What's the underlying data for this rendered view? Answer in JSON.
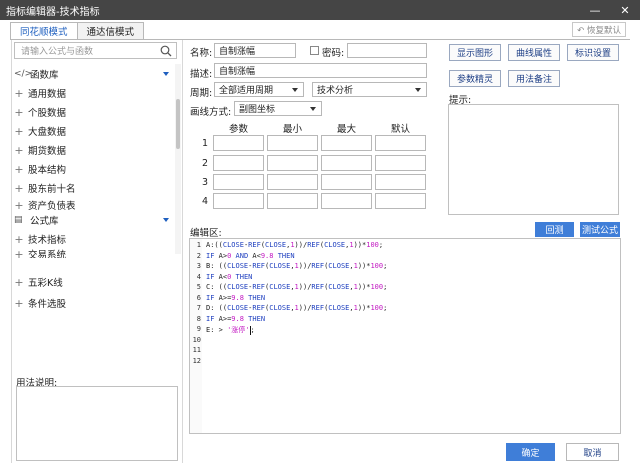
{
  "window": {
    "title": "指标编辑器-技术指标",
    "minimize": "—",
    "close": "✕"
  },
  "tabs": [
    {
      "label": "同花顺模式"
    },
    {
      "label": "通达信模式"
    }
  ],
  "restore_default": "↶ 恢复默认",
  "search": {
    "placeholder": "请输入公式与函数",
    "icon": "search-icon"
  },
  "tree": [
    {
      "label": "函数库",
      "glyph": "</>"
    },
    {
      "label": "通用数据"
    },
    {
      "label": "个股数据"
    },
    {
      "label": "大盘数据"
    },
    {
      "label": "期货数据"
    },
    {
      "label": "股本结构"
    },
    {
      "label": "股东前十名"
    },
    {
      "label": "资产负债表"
    },
    {
      "label": "公式库",
      "glyph": "▤"
    },
    {
      "label": "技术指标"
    },
    {
      "label": "交易系统"
    },
    {
      "label": "五彩K线"
    },
    {
      "label": "条件选股"
    }
  ],
  "usage_label": "用法说明:",
  "form": {
    "name_label": "名称:",
    "name_value": "自制涨幅",
    "password_label": "密码:",
    "desc_label": "描述:",
    "desc_value": "自制涨幅",
    "period_label": "周期:",
    "period_value": "全部适用周期",
    "category_value": "技术分析",
    "draw_label": "画线方式:",
    "draw_value": "副图坐标"
  },
  "params": {
    "headers": [
      "参数",
      "最小",
      "最大",
      "默认"
    ],
    "rows": [
      "1",
      "2",
      "3",
      "4"
    ]
  },
  "right_buttons": [
    "显示图形",
    "曲线属性",
    "标识设置",
    "参数精灵",
    "用法备注"
  ],
  "hint_label": "提示:",
  "editor": {
    "label": "编辑区:",
    "back_button": "回测",
    "test_button": "测试公式",
    "line_numbers": [
      "1",
      "2",
      "3",
      "4",
      "5",
      "6",
      "7",
      "8",
      "9",
      "10",
      "11",
      "12"
    ]
  },
  "ok_button": "确定",
  "cancel_button": "取消"
}
